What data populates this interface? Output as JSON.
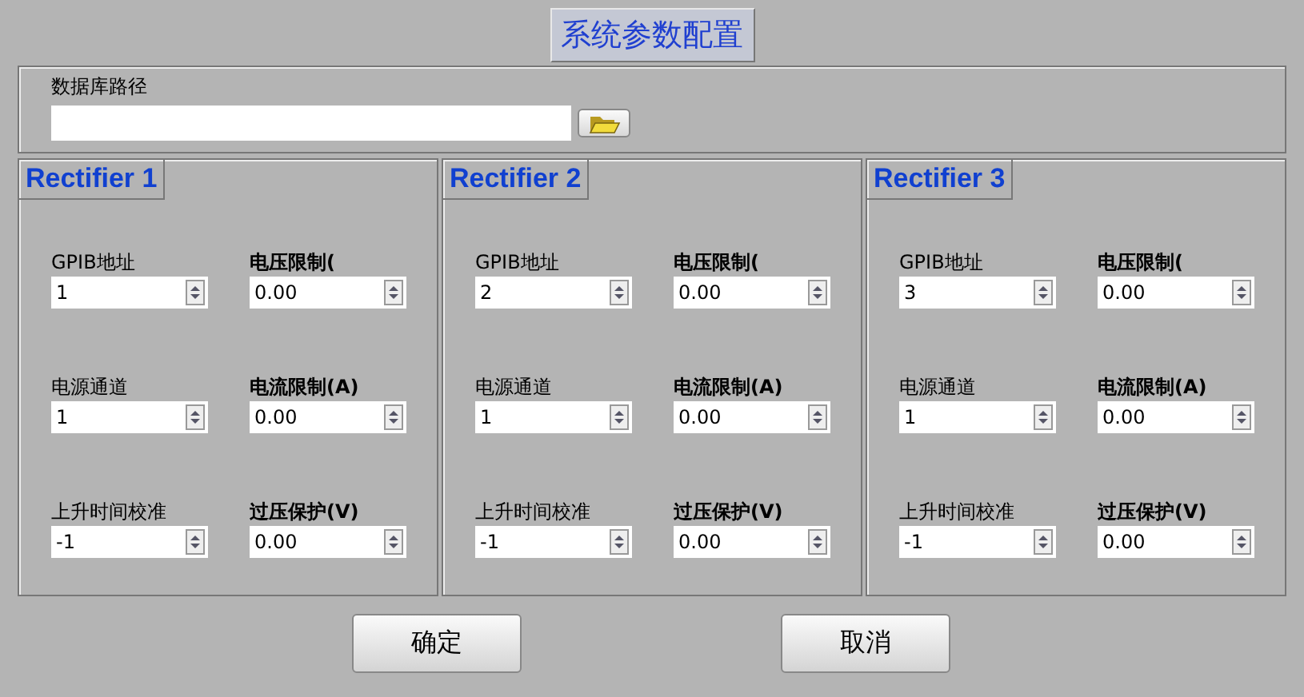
{
  "window": {
    "title": "系统参数配置"
  },
  "database_path": {
    "label": "数据库路径"
  },
  "rectifiers": [
    {
      "title": "Rectifier 1",
      "fields": [
        {
          "kind": "setting",
          "label": "GPIB地址",
          "value": "1"
        },
        {
          "kind": "limit",
          "label": "电压限制(",
          "value": "0.00"
        },
        {
          "kind": "setting",
          "label": "电源通道",
          "value": "1"
        },
        {
          "kind": "limit",
          "label": "电流限制(A)",
          "value": "0.00"
        },
        {
          "kind": "setting",
          "label": "上升时间校准",
          "value": "-1"
        },
        {
          "kind": "limit",
          "label": "过压保护(V)",
          "value": "0.00"
        }
      ]
    },
    {
      "title": "Rectifier 2",
      "fields": [
        {
          "kind": "setting",
          "label": "GPIB地址",
          "value": "2"
        },
        {
          "kind": "limit",
          "label": "电压限制(",
          "value": "0.00"
        },
        {
          "kind": "setting",
          "label": "电源通道",
          "value": "1"
        },
        {
          "kind": "limit",
          "label": "电流限制(A)",
          "value": "0.00"
        },
        {
          "kind": "setting",
          "label": "上升时间校准",
          "value": "-1"
        },
        {
          "kind": "limit",
          "label": "过压保护(V)",
          "value": "0.00"
        }
      ]
    },
    {
      "title": "Rectifier 3",
      "fields": [
        {
          "kind": "setting",
          "label": "GPIB地址",
          "value": "3"
        },
        {
          "kind": "limit",
          "label": "电压限制(",
          "value": "0.00"
        },
        {
          "kind": "setting",
          "label": "电源通道",
          "value": "1"
        },
        {
          "kind": "limit",
          "label": "电流限制(A)",
          "value": "0.00"
        },
        {
          "kind": "setting",
          "label": "上升时间校准",
          "value": "-1"
        },
        {
          "kind": "limit",
          "label": "过压保护(V)",
          "value": "0.00"
        }
      ]
    }
  ],
  "buttons": [
    "确定",
    "取消"
  ]
}
